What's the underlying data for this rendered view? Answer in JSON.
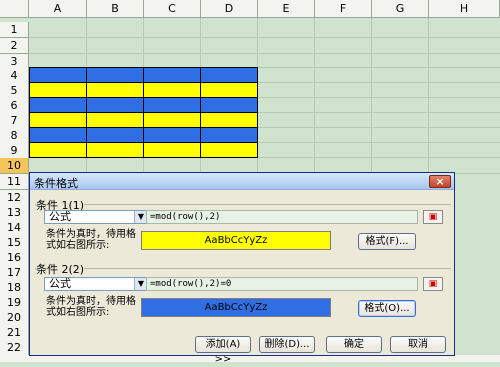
{
  "columns": [
    "A",
    "B",
    "C",
    "D",
    "E",
    "F",
    "G",
    "H"
  ],
  "rows": [
    "1",
    "2",
    "3",
    "4",
    "5",
    "6",
    "7",
    "8",
    "9",
    "10",
    "11",
    "12",
    "13",
    "14",
    "15",
    "16",
    "17",
    "18",
    "19",
    "20",
    "21",
    "22"
  ],
  "active_row": "10",
  "dialog": {
    "title": "条件格式",
    "close_label": "×",
    "condition1": {
      "label": "条件 1(1)",
      "type": "公式",
      "formula": "=mod(row(),2)",
      "ref_icon": "range-select-icon",
      "desc": "条件为真时，待用格式如右图所示:",
      "preview_text": "AaBbCcYyZz",
      "preview_bg": "#ffff00",
      "preview_fg": "#000000",
      "format_button": "格式(F)..."
    },
    "condition2": {
      "label": "条件 2(2)",
      "type": "公式",
      "formula": "=mod(row(),2)=0",
      "ref_icon": "range-select-icon",
      "desc": "条件为真时，待用格式如右图所示:",
      "preview_text": "AaBbCcYyZz",
      "preview_bg": "#2f6fe3",
      "preview_fg": "#000000",
      "format_button": "格式(O)..."
    },
    "buttons": {
      "add": "添加(A) >>",
      "delete": "删除(D)...",
      "ok": "确定",
      "cancel": "取消"
    }
  },
  "colors": {
    "blue_band": "#2f6fe3",
    "yellow_band": "#ffff00",
    "sheet_bg": "#cfe3cf"
  }
}
